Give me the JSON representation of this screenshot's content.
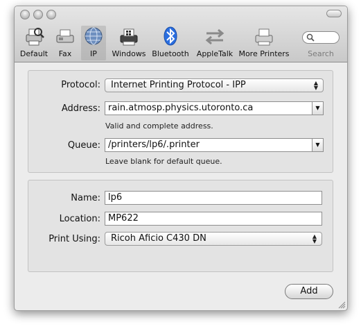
{
  "toolbar": {
    "items": [
      {
        "label": "Default",
        "icon": "default-printer-icon"
      },
      {
        "label": "Fax",
        "icon": "fax-icon"
      },
      {
        "label": "IP",
        "icon": "ip-globe-icon",
        "selected": true
      },
      {
        "label": "Windows",
        "icon": "windows-printer-icon"
      },
      {
        "label": "Bluetooth",
        "icon": "bluetooth-icon"
      },
      {
        "label": "AppleTalk",
        "icon": "appletalk-icon"
      },
      {
        "label": "More Printers",
        "icon": "more-printers-icon"
      }
    ],
    "search_label": "Search",
    "search_value": ""
  },
  "ip_group": {
    "protocol_label": "Protocol:",
    "protocol_value": "Internet Printing Protocol - IPP",
    "address_label": "Address:",
    "address_value": "rain.atmosp.physics.utoronto.ca",
    "address_hint": "Valid and complete address.",
    "queue_label": "Queue:",
    "queue_value": "/printers/lp6/.printer",
    "queue_hint": "Leave blank for default queue."
  },
  "printer_group": {
    "name_label": "Name:",
    "name_value": "lp6",
    "location_label": "Location:",
    "location_value": "MP622",
    "print_using_label": "Print Using:",
    "print_using_value": "Ricoh Aficio C430 DN"
  },
  "add_button": "Add",
  "colors": {
    "bluetooth": "#2a6ee0",
    "toolbar_bg": "#d4d4d4",
    "panel_bg": "#ececec"
  }
}
